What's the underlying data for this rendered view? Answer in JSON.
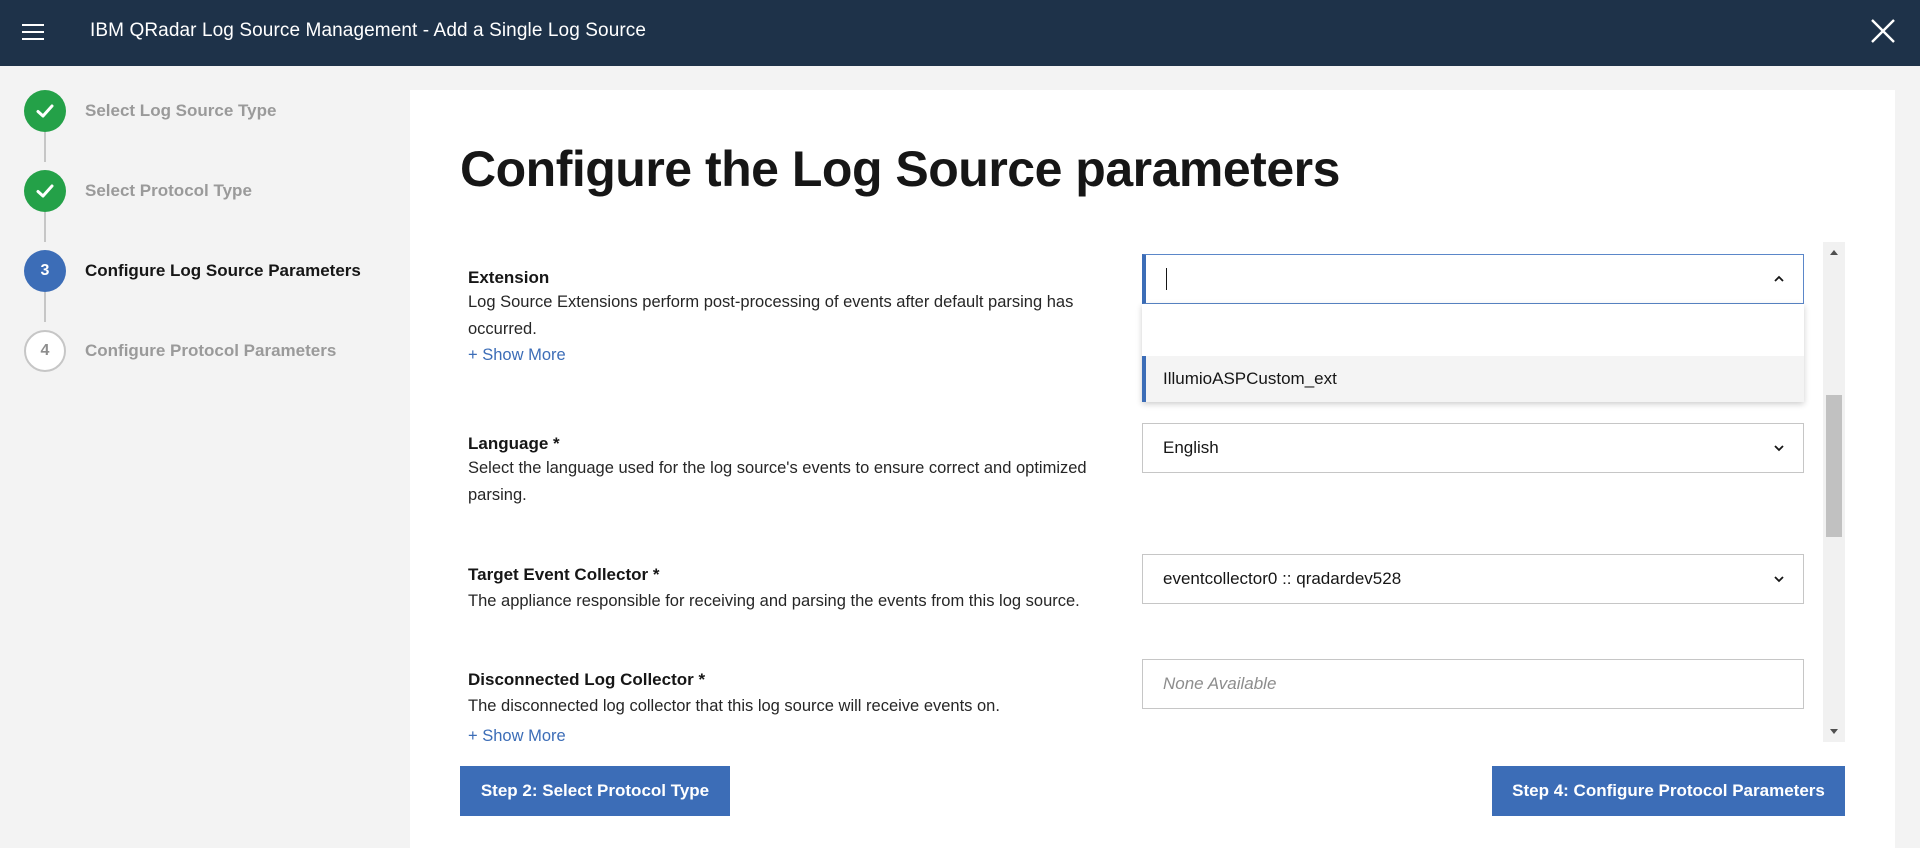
{
  "header": {
    "title": "IBM QRadar Log Source Management - Add a Single Log Source"
  },
  "stepper": {
    "steps": [
      {
        "number": "",
        "label": "Select Log Source Type",
        "status": "done"
      },
      {
        "number": "",
        "label": "Select Protocol Type",
        "status": "done"
      },
      {
        "number": "3",
        "label": "Configure Log Source Parameters",
        "status": "current"
      },
      {
        "number": "4",
        "label": "Configure Protocol Parameters",
        "status": "todo"
      }
    ]
  },
  "main": {
    "title": "Configure the Log Source parameters",
    "fields": {
      "extension": {
        "label": "Extension",
        "description": "Log Source Extensions perform post-processing of events after default parsing has occurred.",
        "show_more": "+ Show More",
        "value": "",
        "options": [
          "IllumioASPCustom_ext"
        ]
      },
      "language": {
        "label": "Language *",
        "description": "Select the language used for the log source's events to ensure correct and optimized parsing.",
        "value": "English"
      },
      "target_collector": {
        "label": "Target Event Collector *",
        "description": "The appliance responsible for receiving and parsing the events from this log source.",
        "value": "eventcollector0 :: qradardev528"
      },
      "disconnected_collector": {
        "label": "Disconnected Log Collector *",
        "description": "The disconnected log collector that this log source will receive events on.",
        "show_more": "+ Show More",
        "placeholder": "None Available"
      }
    },
    "buttons": {
      "prev": "Step 2: Select Protocol Type",
      "next": "Step 4: Configure Protocol Parameters"
    }
  },
  "colors": {
    "header_bg": "#1e3249",
    "accent": "#3c6db7",
    "success": "#24a148"
  }
}
